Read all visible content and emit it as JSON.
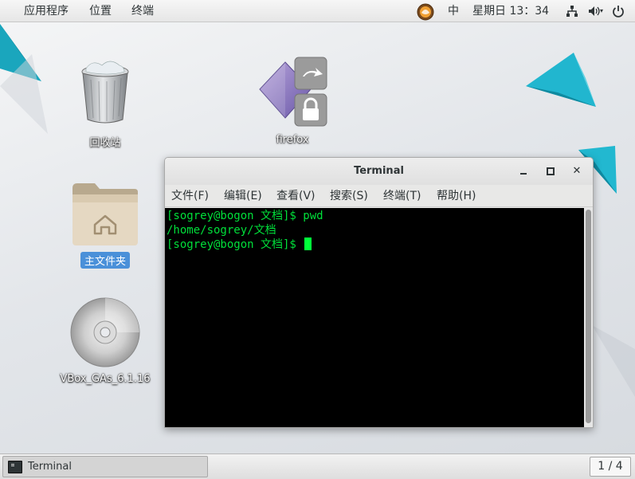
{
  "topbar": {
    "apps": "应用程序",
    "places": "位置",
    "terminal": "终端",
    "input_method": "中",
    "clock": "星期日 13：34",
    "icons": [
      "input-method-icon",
      "network-icon",
      "volume-icon",
      "power-icon"
    ]
  },
  "desktop": {
    "icons": [
      {
        "name": "trash",
        "label": "回收站"
      },
      {
        "name": "firefox",
        "label": "firefox"
      },
      {
        "name": "home-folder",
        "label": "主文件夹"
      },
      {
        "name": "vbox-disc",
        "label": "VBox_GAs_6.1.16"
      }
    ]
  },
  "terminal_window": {
    "title": "Terminal",
    "menu": [
      "文件(F)",
      "编辑(E)",
      "查看(V)",
      "搜索(S)",
      "终端(T)",
      "帮助(H)"
    ],
    "lines": [
      "[sogrey@bogon 文档]$ pwd",
      "/home/sogrey/文档",
      "[sogrey@bogon 文档]$ "
    ]
  },
  "taskbar": {
    "task_label": "Terminal",
    "workspace": "1 / 4"
  },
  "colors": {
    "terminal_text": "#00e03a",
    "terminal_bg": "#000000",
    "accent": "#4a90d9",
    "teal": "#1fb0c8"
  }
}
